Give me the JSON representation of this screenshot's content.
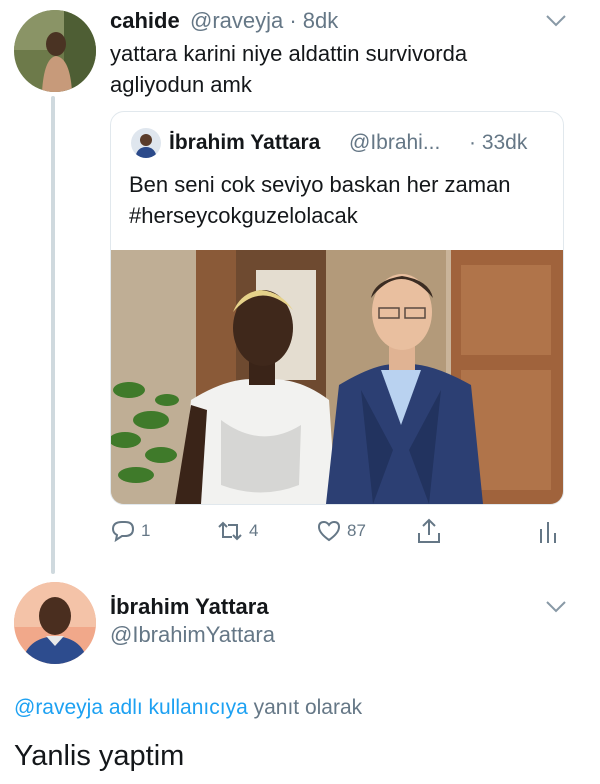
{
  "colors": {
    "link": "#1da1f2",
    "secondary_text": "#657786",
    "primary_text": "#14171a",
    "divider": "#cfd9de"
  },
  "tweet1": {
    "name": "cahide",
    "handle_time": "@raveyja · 8dk",
    "text": "yattara karini niye aldattin survivorda agliyodun amk",
    "avatar_icon": "user-avatar-photo",
    "menu_icon": "chevron-down-icon"
  },
  "quoted_tweet": {
    "name": "İbrahim Yattara",
    "handle": "@Ibrahi...",
    "time": "· 33dk",
    "text": "Ben seni cok seviyo baskan her zaman #herseycokguzelolacak",
    "image_icon": "photo-two-men-image"
  },
  "actions": {
    "reply": {
      "icon": "reply-icon",
      "count": "1"
    },
    "retweet": {
      "icon": "retweet-icon",
      "count": "4"
    },
    "like": {
      "icon": "heart-icon",
      "count": "87"
    },
    "share": {
      "icon": "share-icon"
    },
    "analytics": {
      "icon": "analytics-icon"
    }
  },
  "tweet2": {
    "name": "İbrahim Yattara",
    "handle": "@IbrahimYattara",
    "reply_mention": "@raveyja adlı kullanıcıya",
    "reply_suffix": " yanıt olarak",
    "text": "Yanlis yaptim",
    "menu_icon": "chevron-down-icon"
  }
}
